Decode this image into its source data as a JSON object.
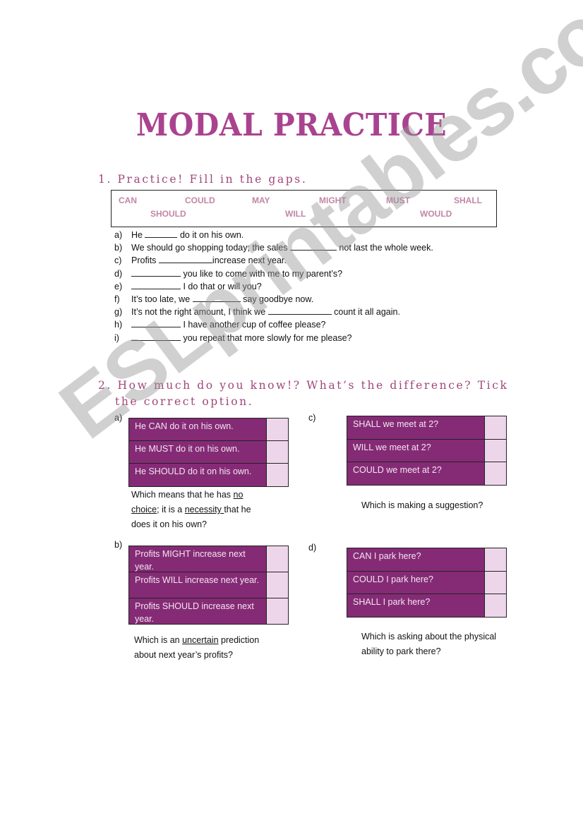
{
  "title": "MODAL PRACTICE",
  "section1": {
    "heading": "1. Practice!  Fill in the gaps.",
    "word_bank": [
      "CAN",
      "COULD",
      "MAY",
      "MIGHT",
      "MUST",
      "SHALL",
      "SHOULD",
      "WILL",
      "WOULD"
    ],
    "sentences": [
      {
        "letter": "a)",
        "before": "He",
        "after": "do it on his own."
      },
      {
        "letter": "b)",
        "before": "We should go shopping today; the sales",
        "after": "not last the whole week."
      },
      {
        "letter": "c)",
        "before": "Profits",
        "after": "increase next year."
      },
      {
        "letter": "d)",
        "before": "",
        "after": "you like to come with me to my parent’s?"
      },
      {
        "letter": "e)",
        "before": "",
        "after": "I do that or will you?"
      },
      {
        "letter": "f)",
        "before": "It’s too late, we",
        "after": "say goodbye now."
      },
      {
        "letter": "g)",
        "before": "It’s not the right amount, I think we",
        "after": "count it all again."
      },
      {
        "letter": "h)",
        "before": "",
        "after": "I have another cup of coffee please?"
      },
      {
        "letter": "i)",
        "before": "",
        "after": "you repeat that more slowly for me please?"
      }
    ]
  },
  "section2": {
    "heading_line1": "2. How much do you know!?  What’s the difference?  Tick",
    "heading_line2": "the correct option.",
    "exercises": {
      "a": {
        "label": "a)",
        "options": [
          "He CAN do it on his own.",
          "He MUST do it on his own.",
          "He SHOULD do it on his own."
        ],
        "question_parts": [
          "Which means that he has ",
          "no choice",
          "; it is a ",
          "necessity ",
          "that he does it on his own?"
        ]
      },
      "b": {
        "label": "b)",
        "options": [
          "Profits MIGHT increase next year.",
          "Profits WILL increase next year.",
          "Profits SHOULD increase next year."
        ],
        "question_parts": [
          "Which is an ",
          "uncertain",
          " prediction about next year’s profits?"
        ]
      },
      "c": {
        "label": "c)",
        "options": [
          "SHALL we meet at 2?",
          "WILL we meet at 2?",
          "COULD we meet at 2?"
        ],
        "question": "Which is making a suggestion?"
      },
      "d": {
        "label": "d)",
        "options": [
          "CAN I park here?",
          "COULD I park here?",
          "SHALL I park here?"
        ],
        "question": "Which is asking about the physical ability to park there?"
      }
    }
  },
  "watermark": "ESLprintables.com",
  "colors": {
    "title": "#a9438f",
    "heading": "#a0467a",
    "word_bank": "#c386a6",
    "option_bg": "#852b76",
    "tick_bg": "#eed6ea"
  }
}
